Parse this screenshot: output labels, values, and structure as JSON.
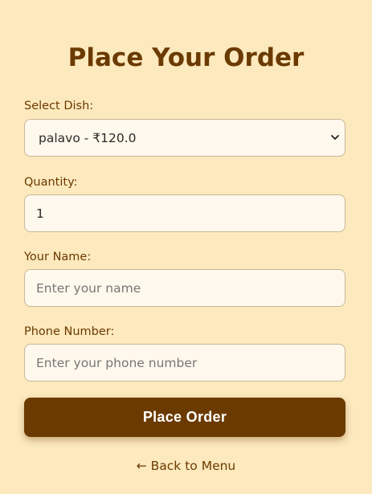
{
  "page": {
    "title": "Place Your Order"
  },
  "form": {
    "dish": {
      "label": "Select Dish:",
      "selected": "palavo - ₹120.0",
      "options": [
        "palavo - ₹120.0"
      ]
    },
    "quantity": {
      "label": "Quantity:",
      "value": "1"
    },
    "name": {
      "label": "Your Name:",
      "placeholder": "Enter your name"
    },
    "phone": {
      "label": "Phone Number:",
      "placeholder": "Enter your phone number"
    },
    "submit_label": "Place Order"
  },
  "nav": {
    "back_label": "← Back to Menu"
  },
  "icons": {
    "dropdown": "chevron-down-icon"
  },
  "colors": {
    "background": "#fce9bd",
    "accent": "#6b3a00",
    "field_background": "#fff8ec",
    "button_text": "#ffffff"
  }
}
